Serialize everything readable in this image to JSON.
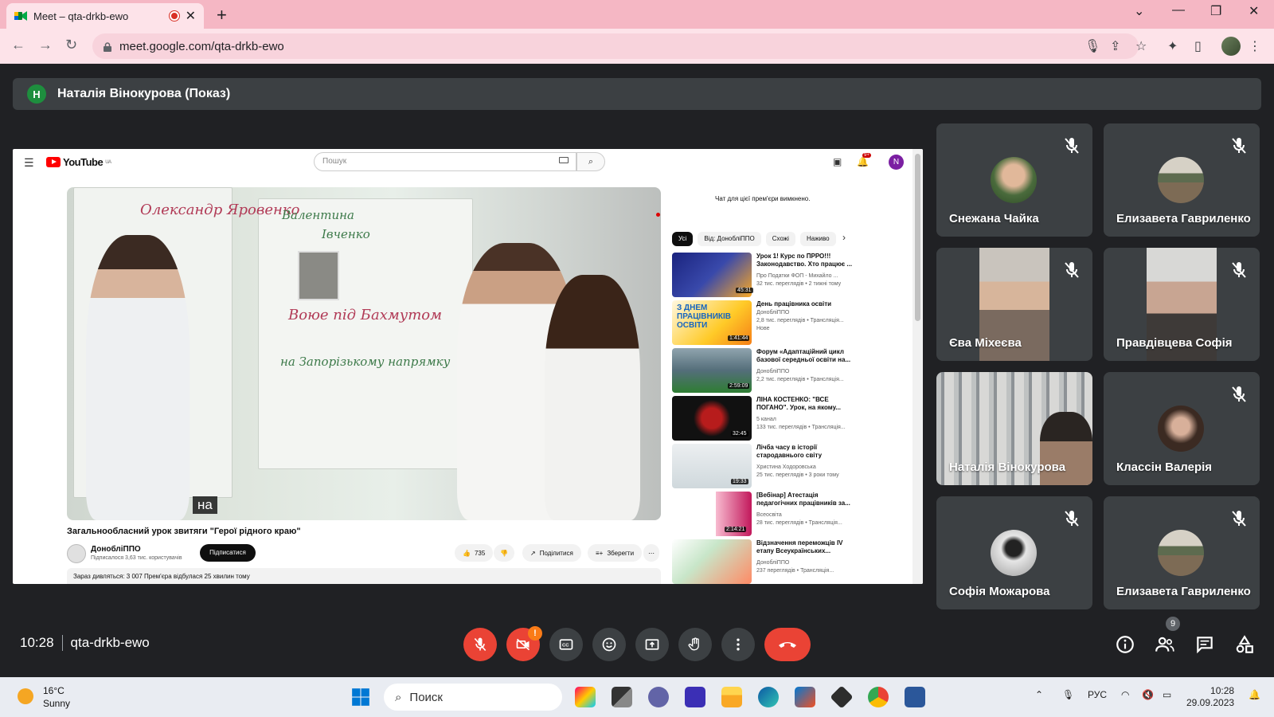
{
  "browser": {
    "tab_title": "Meet – qta-drkb-ewo",
    "url": "meet.google.com/qta-drkb-ewo"
  },
  "meet": {
    "presenter_initial": "Н",
    "presenter_label": "Наталія Вінокурова (Показ)",
    "time": "10:28",
    "meeting_code": "qta-drkb-ewo",
    "participants_count": "9",
    "camera_warning": "!"
  },
  "youtube": {
    "logo_text": "YouTube",
    "logo_region": "UA",
    "search_placeholder": "Пошук",
    "notif_badge": "9+",
    "avatar_letter": "N",
    "caption": "на",
    "video_title": "Загальнообласний урок звитяги \"Герої рідного краю\"",
    "channel_name": "ДонобліППО",
    "channel_subs": "Підписалося 3,63 тис. користувачів",
    "subscribe": "Підписатися",
    "likes": "735",
    "share": "Поділитися",
    "save": "Зберегти",
    "desc_line": "Зараз дивляться: 3 007  Прем'єра відбулася 25 хвилин тому",
    "chat_disabled": "Чат для цієї прем'єри вимкнено.",
    "chips": [
      "Усі",
      "Від: ДонобліППО",
      "Схожі",
      "Наживо"
    ],
    "recommendations": [
      {
        "title": "Урок 1! Курс по ПРРО!!! Законодавство. Хто працює ...",
        "channel": "Про Податки ФОП - Михайло ...",
        "views": "32 тис. переглядів  • 2 тижні тому",
        "note": "",
        "duration": "45:31"
      },
      {
        "title": "День працівника освіти",
        "channel": "ДонобліППО",
        "views": "2,8 тис. переглядів  • Трансляція...",
        "note": "Нове",
        "duration": "1:41:44"
      },
      {
        "title": "Форум «Адаптаційний цикл базової середньої освіти на...",
        "channel": "ДонобліППО",
        "views": "2,2 тис. переглядів  • Трансляція...",
        "note": "",
        "duration": "2:59:09"
      },
      {
        "title": "ЛІНА КОСТЕНКО: \"ВСЕ ПОГАНО\". Урок, на якому...",
        "channel": "5 канал",
        "views": "133 тис. переглядів  • Трансляція...",
        "note": "",
        "duration": "32:45"
      },
      {
        "title": "Лічба часу в історії стародавнього світу",
        "channel": "Христина Ходоровська",
        "views": "25 тис. переглядів  • 3 роки тому",
        "note": "",
        "duration": "19:33"
      },
      {
        "title": "[Вебінар] Атестація педагогічних працівників за...",
        "channel": "Всеосвіта",
        "views": "28 тис. переглядів  • Трансляція...",
        "note": "",
        "duration": "2:14:21"
      },
      {
        "title": "Відзначення переможців IV етапу Всеукраїнських...",
        "channel": "ДонобліППО",
        "views": "237 переглядів  • Трансляція...",
        "note": "",
        "duration": ""
      }
    ]
  },
  "participants": [
    {
      "name": "Снежана Чайка",
      "muted": true
    },
    {
      "name": "Елизавета Гавриленко",
      "muted": true
    },
    {
      "name": "Єва Міхеєва",
      "muted": true
    },
    {
      "name": "Правдівцева Софія",
      "muted": true
    },
    {
      "name": "Наталія Вінокурова",
      "muted": false
    },
    {
      "name": "Классін Валерія",
      "muted": true
    },
    {
      "name": "Софія Можарова",
      "muted": true
    },
    {
      "name": "Елизавета Гавриленко",
      "muted": true
    }
  ],
  "taskbar": {
    "temperature": "16°C",
    "condition": "Sunny",
    "search": "Поиск",
    "language": "РУС",
    "time": "10:28",
    "date": "29.09.2023"
  },
  "colors": {
    "meet_bg": "#202124",
    "tile_bg": "#3c4043",
    "end_call": "#ea4335",
    "tab_strip": "#f5b7c4"
  }
}
